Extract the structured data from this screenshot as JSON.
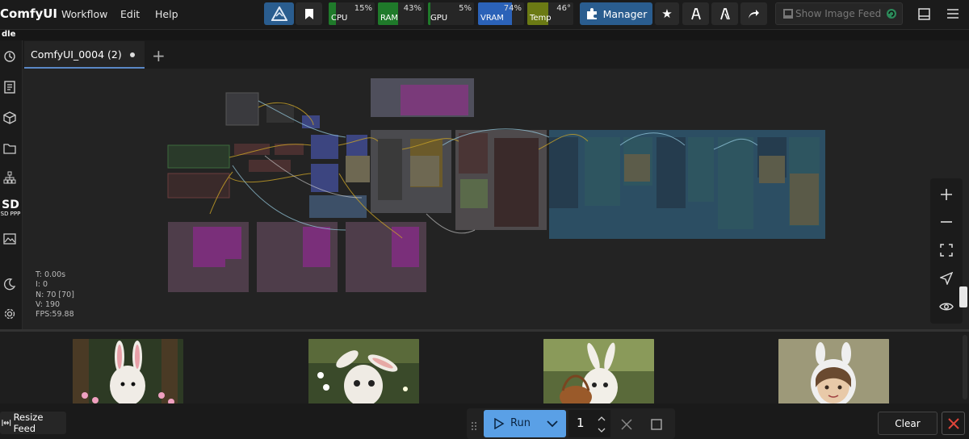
{
  "app": {
    "title": "ComfyUI",
    "menu": [
      "Workflow",
      "Edit",
      "Help"
    ]
  },
  "monitors": [
    {
      "label": "CPU",
      "percent": 15,
      "value_text": "15%",
      "color": "#1f7a2a"
    },
    {
      "label": "RAM",
      "percent": 43,
      "value_text": "43%",
      "color": "#1f7a2a"
    },
    {
      "label": "GPU",
      "percent": 5,
      "value_text": "5%",
      "color": "#1f7a2a"
    },
    {
      "label": "VRAM",
      "percent": 74,
      "value_text": "74%",
      "color": "#2b62b8"
    },
    {
      "label": "Temp",
      "percent": 46,
      "value_text": "46°",
      "color": "#6b7a14"
    }
  ],
  "toolbar": {
    "manager_label": "Manager",
    "show_feed_label": "Show Image Feed"
  },
  "status_line": "dle",
  "tabs": [
    {
      "label": "ComfyUI_0004 (2)",
      "unsaved": true
    }
  ],
  "sidebar": {
    "items": [
      "history-icon",
      "queue-icon",
      "model-library-icon",
      "workflows-icon",
      "node-library-icon",
      "sd-ppp-icon",
      "image-icon"
    ],
    "sd_ppp_label": "SD PPP",
    "bottom": [
      "theme-icon",
      "settings-icon"
    ]
  },
  "canvas_stats": [
    "T: 0.00s",
    "I: 0",
    "N: 70 [70]",
    "V: 190",
    "FPS:59.88"
  ],
  "zoom_controls": [
    "zoom-in-icon",
    "zoom-out-icon",
    "fit-view-icon",
    "locate-icon",
    "visibility-icon"
  ],
  "feed": {
    "images": [
      "bunny-flowers-forest",
      "bunny-white-flowers",
      "bunny-basket-forest",
      "girl-bunny-hood"
    ]
  },
  "bottombar": {
    "resize_feed_label": "Resize Feed",
    "run_label": "Run",
    "batch_count": "1",
    "clear_label": "Clear"
  },
  "colors": {
    "accent_blue": "#5aa0e6",
    "tab_underline": "#5a88c6",
    "danger": "#e0453a"
  }
}
